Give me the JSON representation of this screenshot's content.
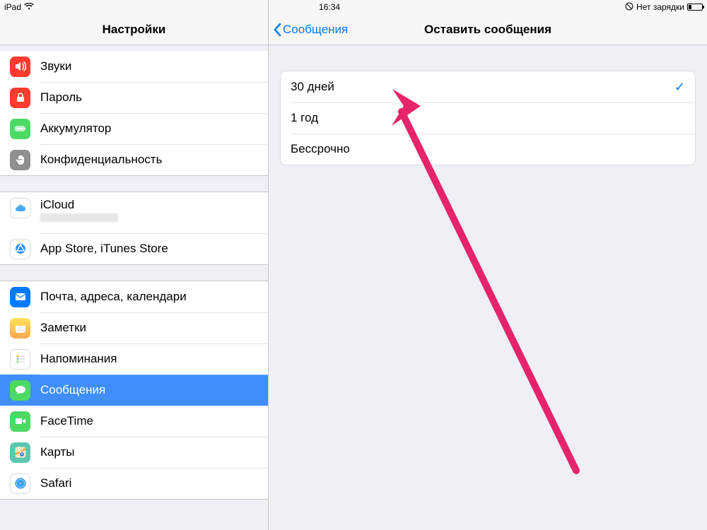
{
  "status": {
    "device": "iPad",
    "time": "16:34",
    "right_text": "Нет зарядки"
  },
  "sidebar": {
    "title": "Настройки",
    "groups": [
      {
        "id": "g0",
        "partial_top": true,
        "items": [
          {
            "id": "sounds",
            "label": "Звуки",
            "icon": "speaker-icon",
            "cls": "ic-red"
          },
          {
            "id": "passcode",
            "label": "Пароль",
            "icon": "lock-icon",
            "cls": "ic-red"
          },
          {
            "id": "battery",
            "label": "Аккумулятор",
            "icon": "battery-icon",
            "cls": "ic-green"
          },
          {
            "id": "privacy",
            "label": "Конфиденциальность",
            "icon": "hand-icon",
            "cls": "ic-gray"
          }
        ]
      },
      {
        "id": "g1",
        "items": [
          {
            "id": "icloud",
            "label": "iCloud",
            "icon": "cloud-icon",
            "cls": "ic-white",
            "tall": true
          },
          {
            "id": "appstore",
            "label": "App Store, iTunes Store",
            "icon": "appstore-icon",
            "cls": "ic-white"
          }
        ]
      },
      {
        "id": "g2",
        "items": [
          {
            "id": "mail",
            "label": "Почта, адреса, календари",
            "icon": "mail-icon",
            "cls": "ic-blue"
          },
          {
            "id": "notes",
            "label": "Заметки",
            "icon": "notes-icon",
            "cls": "ic-yellow"
          },
          {
            "id": "reminders",
            "label": "Напоминания",
            "icon": "reminders-icon",
            "cls": "ic-white"
          },
          {
            "id": "messages",
            "label": "Сообщения",
            "icon": "messages-icon",
            "cls": "ic-imessage",
            "selected": true
          },
          {
            "id": "facetime",
            "label": "FaceTime",
            "icon": "facetime-icon",
            "cls": "ic-green"
          },
          {
            "id": "maps",
            "label": "Карты",
            "icon": "maps-icon",
            "cls": "ic-teal"
          },
          {
            "id": "safari",
            "label": "Safari",
            "icon": "safari-icon",
            "cls": "ic-white"
          }
        ]
      }
    ]
  },
  "detail": {
    "back_label": "Сообщения",
    "title": "Оставить сообщения",
    "options": [
      {
        "id": "30d",
        "label": "30 дней",
        "selected": true
      },
      {
        "id": "1y",
        "label": "1 год",
        "selected": false
      },
      {
        "id": "forever",
        "label": "Бессрочно",
        "selected": false
      }
    ]
  },
  "annotation": {
    "arrow_color": "#e6246a"
  }
}
